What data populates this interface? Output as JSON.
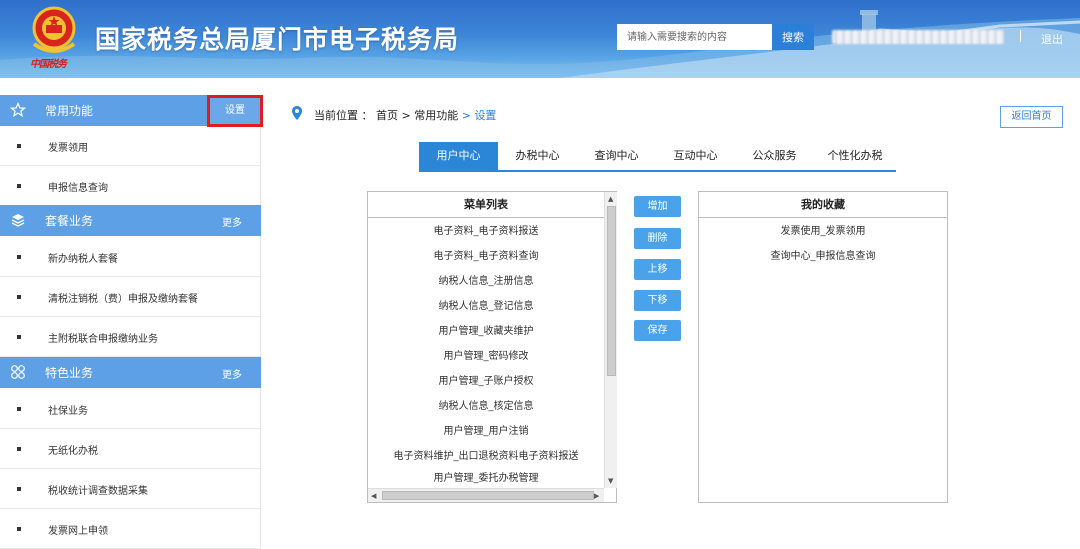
{
  "header": {
    "site_title": "国家税务总局厦门市电子税务局",
    "emblem_text": "中国税务",
    "search_placeholder": "请输入需要搜索的内容",
    "search_button": "搜索",
    "separator": "|",
    "logout": "退出"
  },
  "sidebar": {
    "common": {
      "title": "常用功能",
      "settings": "设置",
      "items": [
        "发票领用",
        "申报信息查询"
      ]
    },
    "package": {
      "title": "套餐业务",
      "more": "更多",
      "items": [
        "新办纳税人套餐",
        "清税注销税（费）申报及缴纳套餐",
        "主附税联合申报缴纳业务"
      ]
    },
    "special": {
      "title": "特色业务",
      "more": "更多",
      "items": [
        "社保业务",
        "无纸化办税",
        "税收统计调查数据采集",
        "发票网上申领"
      ]
    }
  },
  "main": {
    "breadcrumb": {
      "label": "当前位置 ：",
      "home": "首页",
      "sep1": " >",
      "section": "常用功能",
      "sep2": " >",
      "current": "设置"
    },
    "back_home": "返回首页",
    "tabs": [
      "用户中心",
      "办税中心",
      "查询中心",
      "互动中心",
      "公众服务",
      "个性化办税"
    ],
    "active_tab": 0,
    "menu_list": {
      "title": "菜单列表",
      "items": [
        "电子资料_电子资料报送",
        "电子资料_电子资料查询",
        "纳税人信息_注册信息",
        "纳税人信息_登记信息",
        "用户管理_收藏夹维护",
        "用户管理_密码修改",
        "用户管理_子账户授权",
        "纳税人信息_核定信息",
        "用户管理_用户注销",
        "电子资料维护_出口退税资料电子资料报送",
        "用户管理_委托办税管理"
      ]
    },
    "buttons": [
      "增加",
      "删除",
      "上移",
      "下移",
      "保存"
    ],
    "favorites": {
      "title": "我的收藏",
      "items": [
        "发票使用_发票领用",
        "查询中心_申报信息查询"
      ]
    }
  },
  "colors": {
    "primary": "#2b86d8",
    "section_header": "#5ea0e6",
    "highlight_border": "#e01b22"
  }
}
